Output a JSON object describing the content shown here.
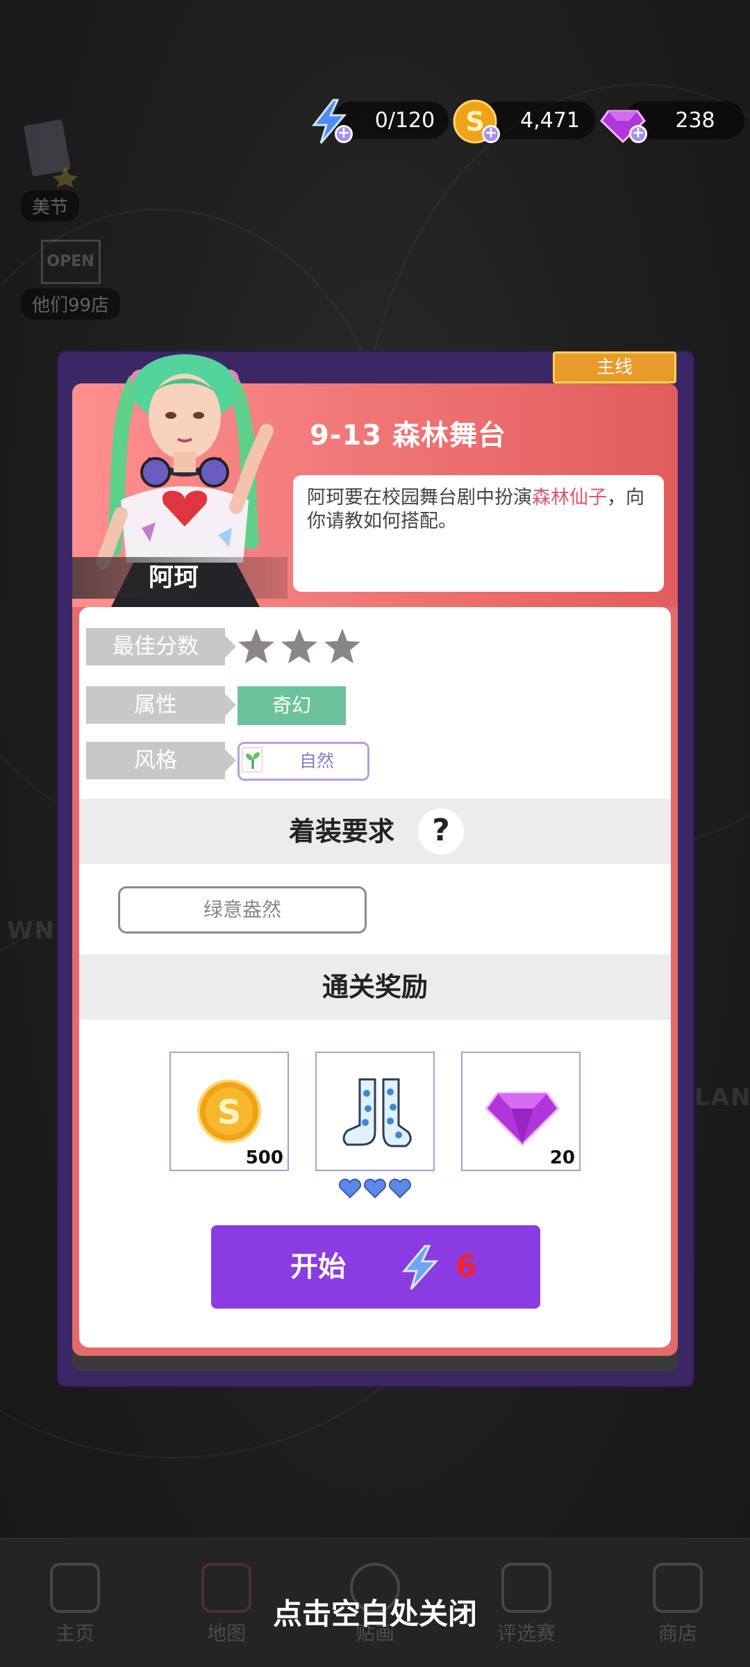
{
  "currencies": {
    "energy": {
      "value": "0/120",
      "icon": "lightning-icon"
    },
    "coins": {
      "value": "4,471",
      "icon": "coin-icon"
    },
    "gems": {
      "value": "238",
      "icon": "gem-icon"
    }
  },
  "side": {
    "top_item": {
      "label": "美节"
    },
    "shop_item": {
      "label": "他们99店",
      "sign": "OPEN"
    }
  },
  "dialog": {
    "tag": "主线",
    "level_title": "9-13  森林舞台",
    "character_name": "阿珂",
    "description": {
      "before": "阿珂要在校园舞台剧中扮演",
      "highlight": "森林仙子",
      "after": "，向你请教如何搭配。"
    },
    "rows": {
      "best_score_label": "最佳分数",
      "best_score_stars": 0,
      "attribute_label": "属性",
      "attribute_value": "奇幻",
      "style_label": "风格",
      "style_value": "自然"
    },
    "dress_requirement": {
      "title": "着装要求",
      "help": "?",
      "tag": "绿意盎然"
    },
    "rewards": {
      "title": "通关奖励",
      "items": [
        {
          "icon": "coin-icon",
          "count": "500"
        },
        {
          "icon": "socks-icon",
          "count": ""
        },
        {
          "icon": "gem-icon",
          "count": "20"
        }
      ],
      "socks_hearts": 3
    },
    "start_button": {
      "label": "开始",
      "cost": "6"
    }
  },
  "bottom_nav": {
    "items": [
      {
        "label": "主页"
      },
      {
        "label": "地图"
      },
      {
        "label": "贴画"
      },
      {
        "label": "评选赛"
      },
      {
        "label": "商店"
      }
    ]
  },
  "close_hint": "点击空白处关闭",
  "colors": {
    "accent_purple": "#8a3ce2",
    "highlight_pink": "#e4546b",
    "header_red": "#e56a6a",
    "attr_green": "#6cc29c",
    "cost_red": "#f0222e"
  }
}
